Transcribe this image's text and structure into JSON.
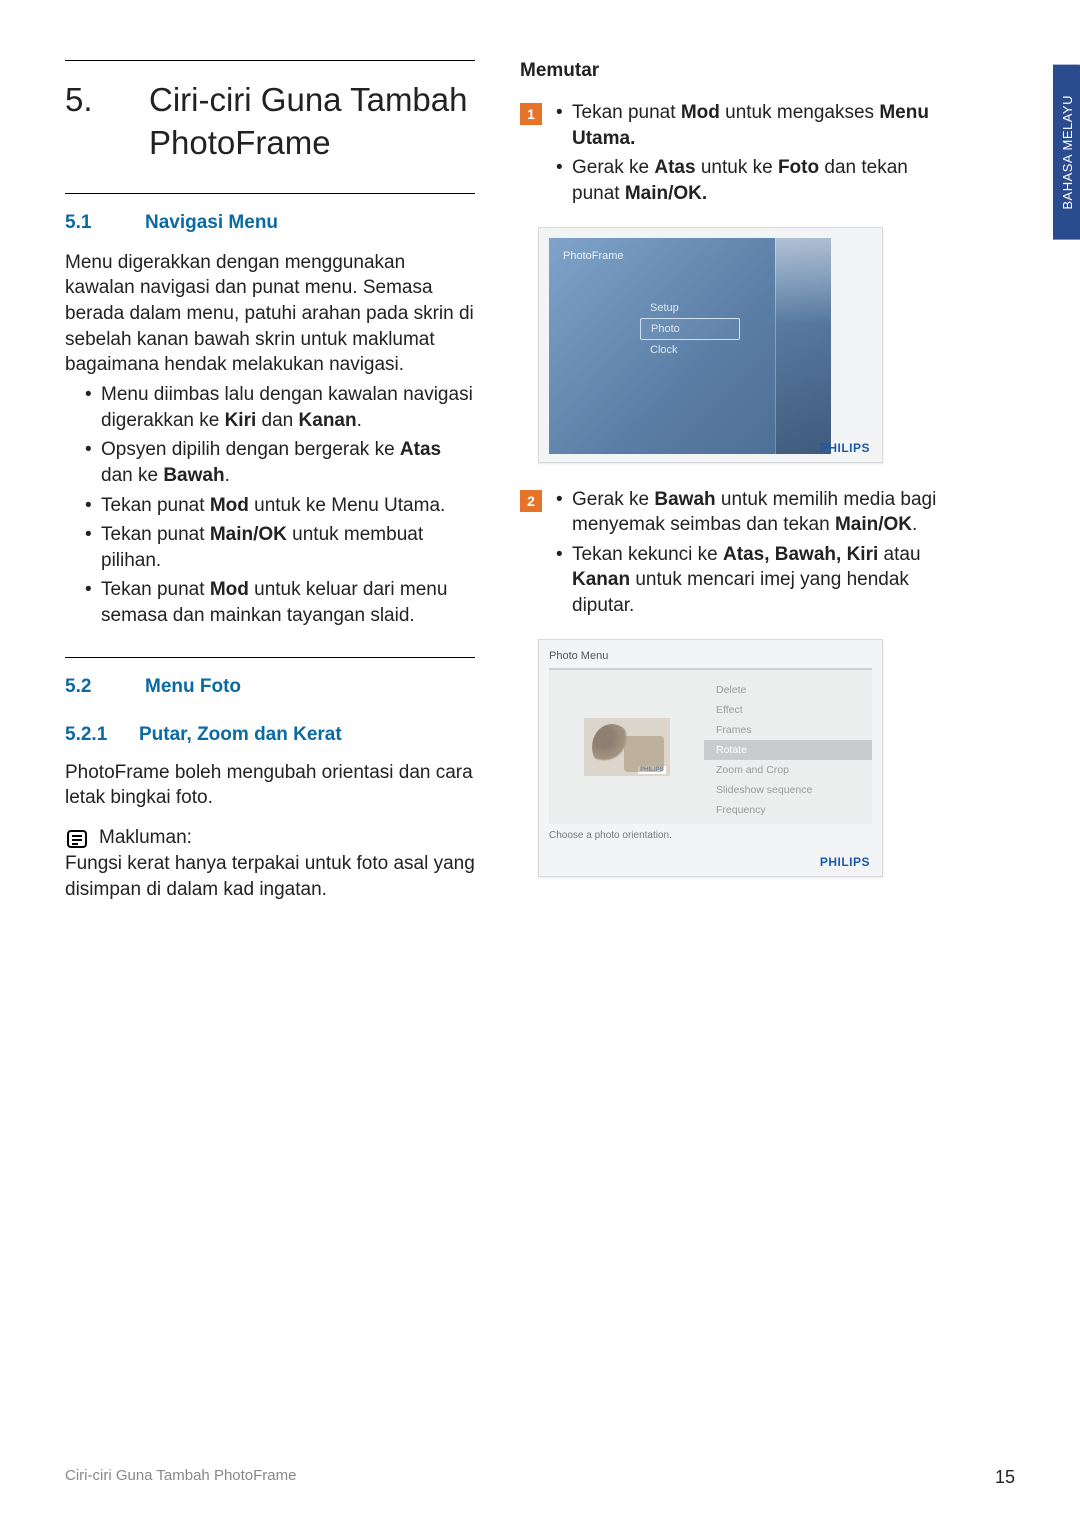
{
  "side_tab": "BAHASA MELAYU",
  "chapter": {
    "num": "5.",
    "title": "Ciri-ciri Guna Tambah PhotoFrame"
  },
  "sec51": {
    "num": "5.1",
    "title": "Navigasi Menu",
    "para": "Menu digerakkan dengan menggunakan kawalan navigasi dan punat menu. Semasa berada dalam menu, patuhi arahan pada skrin di sebelah kanan bawah skrin untuk maklumat bagaimana hendak melakukan navigasi.",
    "items": [
      {
        "pre": "Menu diimbas lalu dengan kawalan navigasi digerakkan ke ",
        "b1": "Kiri",
        "mid": " dan ",
        "b2": "Kanan",
        "post": "."
      },
      {
        "pre": "Opsyen dipilih dengan bergerak ke ",
        "b1": "Atas",
        "mid": " dan ke ",
        "b2": "Bawah",
        "post": "."
      },
      {
        "pre": "Tekan punat ",
        "b1": "Mod",
        "mid": " untuk ke Menu Utama.",
        "b2": "",
        "post": ""
      },
      {
        "pre": "Tekan punat ",
        "b1": "Main/OK",
        "mid": " untuk membuat pilihan.",
        "b2": "",
        "post": ""
      },
      {
        "pre": "Tekan punat ",
        "b1": "Mod",
        "mid": " untuk keluar dari menu semasa dan mainkan tayangan slaid.",
        "b2": "",
        "post": ""
      }
    ]
  },
  "sec52": {
    "num": "5.2",
    "title": "Menu Foto"
  },
  "sec521": {
    "num": "5.2.1",
    "title": "Putar, Zoom dan Kerat",
    "para": "PhotoFrame boleh mengubah orientasi dan cara letak bingkai foto.",
    "note_label": "Makluman:",
    "note_text": "Fungsi kerat hanya terpakai untuk foto asal yang disimpan di dalam kad ingatan."
  },
  "right": {
    "title": "Memutar",
    "step1": {
      "num": "1",
      "a_pre": "Tekan punat ",
      "a_b1": "Mod",
      "a_mid": " untuk mengakses ",
      "a_b2": "Menu Utama.",
      "b_pre": "Gerak ke ",
      "b_b1": "Atas",
      "b_mid": " untuk ke ",
      "b_b2": "Foto",
      "b_mid2": " dan tekan punat ",
      "b_b3": "Main/OK."
    },
    "step2": {
      "num": "2",
      "a_pre": "Gerak ke ",
      "a_b1": "Bawah",
      "a_mid": " untuk memilih media bagi menyemak seimbas dan tekan ",
      "a_b2": "Main/OK",
      "a_post": ".",
      "b_pre": "Tekan kekunci ke ",
      "b_b1": "Atas, Bawah, Kiri",
      "b_mid": " atau ",
      "b_b2": "Kanan",
      "b_post": " untuk mencari imej yang hendak diputar."
    }
  },
  "fig1": {
    "title": "PhotoFrame",
    "items": [
      "Setup",
      "Photo",
      "Clock"
    ],
    "selected_index": 1,
    "brand": "PHILIPS"
  },
  "fig2": {
    "title": "Photo Menu",
    "items": [
      "Delete",
      "Effect",
      "Frames",
      "Rotate",
      "Zoom and Crop",
      "Slideshow sequence",
      "Frequency"
    ],
    "highlight_index": 3,
    "hint": "Choose a photo orientation.",
    "brand": "PHILIPS",
    "thumb_brand": "PHILIPS"
  },
  "footer": {
    "left": "Ciri-ciri Guna Tambah PhotoFrame",
    "page": "15"
  }
}
